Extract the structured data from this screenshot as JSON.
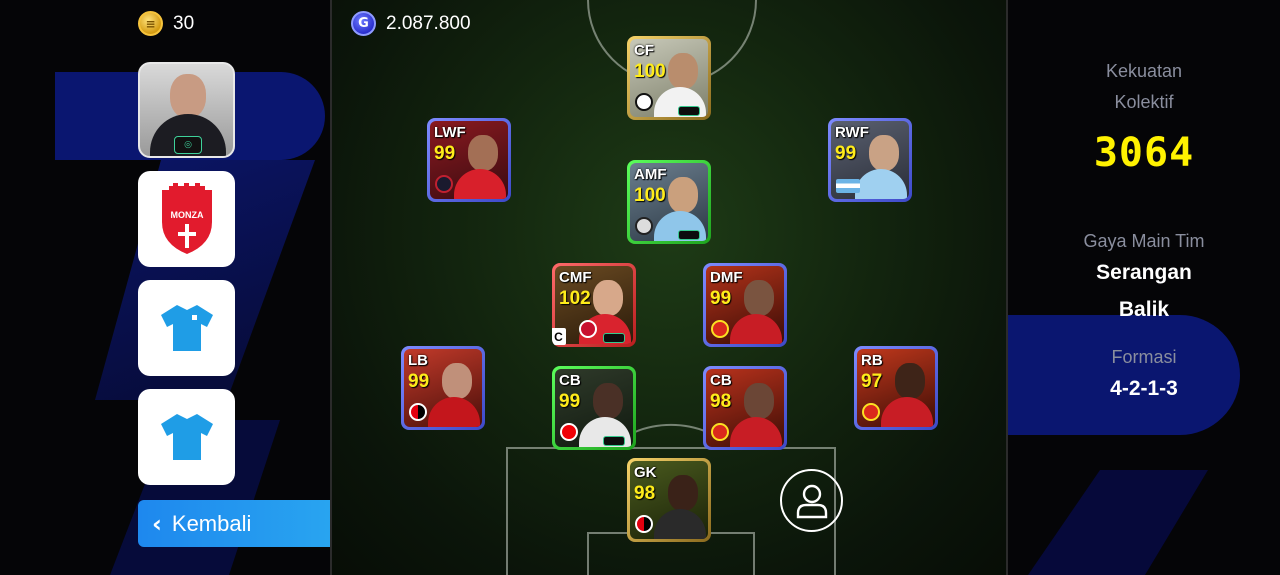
{
  "currency": {
    "coins": "30",
    "gp": "2.087.800",
    "coin_icon": "coin-icon",
    "gp_icon": "gp-icon",
    "gp_symbol": "G"
  },
  "sidebar": {
    "manager_icon": "manager-portrait",
    "club_name": "MONZA",
    "kit_icon": "shirt-icon",
    "back_label": "Kembali"
  },
  "players": [
    {
      "pos": "CF",
      "rating": "100",
      "border": "gold"
    },
    {
      "pos": "LWF",
      "rating": "99",
      "border": "blue"
    },
    {
      "pos": "RWF",
      "rating": "99",
      "border": "blue"
    },
    {
      "pos": "AMF",
      "rating": "100",
      "border": "green"
    },
    {
      "pos": "CMF",
      "rating": "102",
      "border": "red",
      "captain": "C"
    },
    {
      "pos": "DMF",
      "rating": "99",
      "border": "blue"
    },
    {
      "pos": "LB",
      "rating": "99",
      "border": "blue"
    },
    {
      "pos": "CB",
      "rating": "99",
      "border": "green"
    },
    {
      "pos": "CB",
      "rating": "98",
      "border": "blue"
    },
    {
      "pos": "RB",
      "rating": "97",
      "border": "blue"
    },
    {
      "pos": "GK",
      "rating": "98",
      "border": "gold"
    }
  ],
  "team_info": {
    "strength_label_1": "Kekuatan",
    "strength_label_2": "Kolektif",
    "strength_value": "3064",
    "style_label": "Gaya Main Tim",
    "style_value_1": "Serangan",
    "style_value_2": "Balik",
    "formation_label": "Formasi",
    "formation_value": "4-2-1-3"
  },
  "colors": {
    "accent_blue": "#1e88ee",
    "rating_yellow": "#ffec1a",
    "strength_yellow": "#fff200"
  }
}
